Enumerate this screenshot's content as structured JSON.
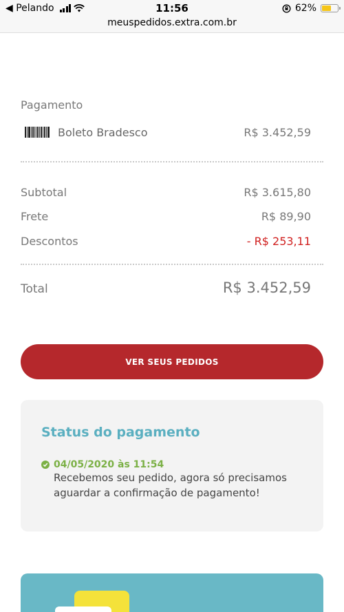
{
  "statusbar": {
    "back_label": "◀ Pelando",
    "time": "11:56",
    "battery_percent": "62%",
    "battery_level": 0.62
  },
  "browser": {
    "url": "meuspedidos.extra.com.br"
  },
  "payment": {
    "section_label": "Pagamento",
    "method": "Boleto Bradesco",
    "amount": "R$ 3.452,59"
  },
  "summary": {
    "subtotal_label": "Subtotal",
    "subtotal_value": "R$ 3.615,80",
    "frete_label": "Frete",
    "frete_value": "R$ 89,90",
    "descontos_label": "Descontos",
    "descontos_value": "- R$ 253,11",
    "total_label": "Total",
    "total_value": "R$ 3.452,59"
  },
  "actions": {
    "ver_pedidos_label": "VER SEUS PEDIDOS"
  },
  "status": {
    "title": "Status do pagamento",
    "date": "04/05/2020 às 11:54",
    "message": "Recebemos seu pedido, agora só precisamos aguardar a confirmação de pagamento!"
  },
  "colors": {
    "primary_red": "#b5282c",
    "status_title": "#5aafc0",
    "status_green": "#7bb045",
    "discount_red": "#d0201f",
    "promo_teal": "#69b8c6"
  }
}
